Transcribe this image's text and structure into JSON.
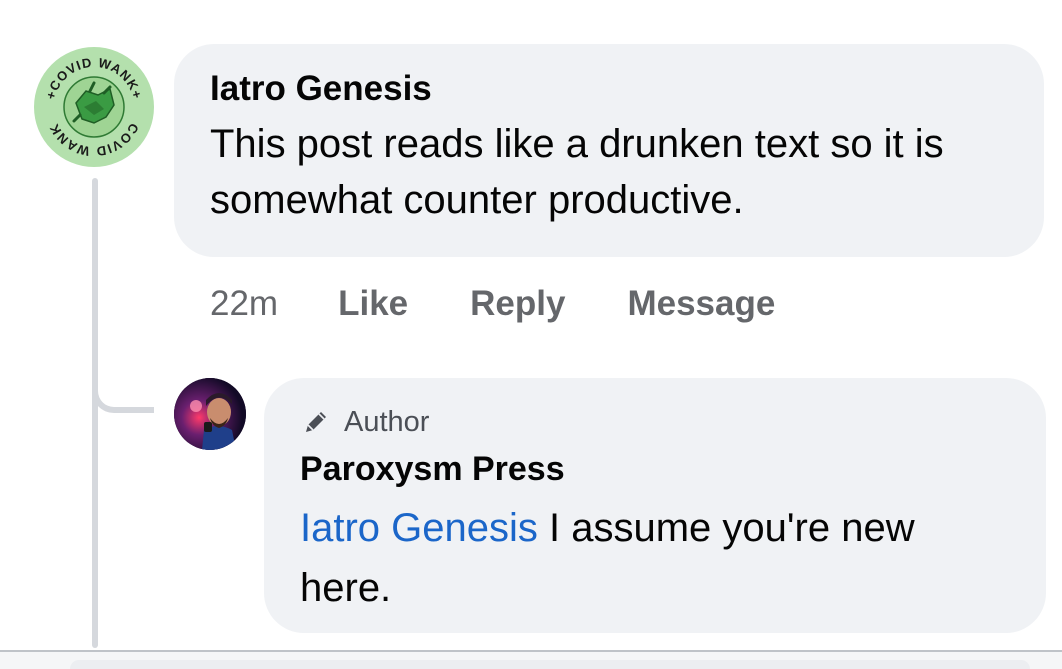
{
  "comment": {
    "author_name": "Iatro Genesis",
    "text": "This post reads like a drunken text so it is somewhat counter productive.",
    "avatar_label": "+COVID WANK +COVID WANK",
    "time": "22m",
    "actions": {
      "like": "Like",
      "reply": "Reply",
      "message": "Message"
    }
  },
  "reply": {
    "badge": "Author",
    "author_name": "Paroxysm Press",
    "mention": "Iatro Genesis",
    "text": " I assume you're new here."
  },
  "colors": {
    "bubble": "#f0f2f5",
    "mention": "#1b66c9",
    "muted": "#65676b",
    "covid_avatar_bg": "#b4e0ad"
  }
}
